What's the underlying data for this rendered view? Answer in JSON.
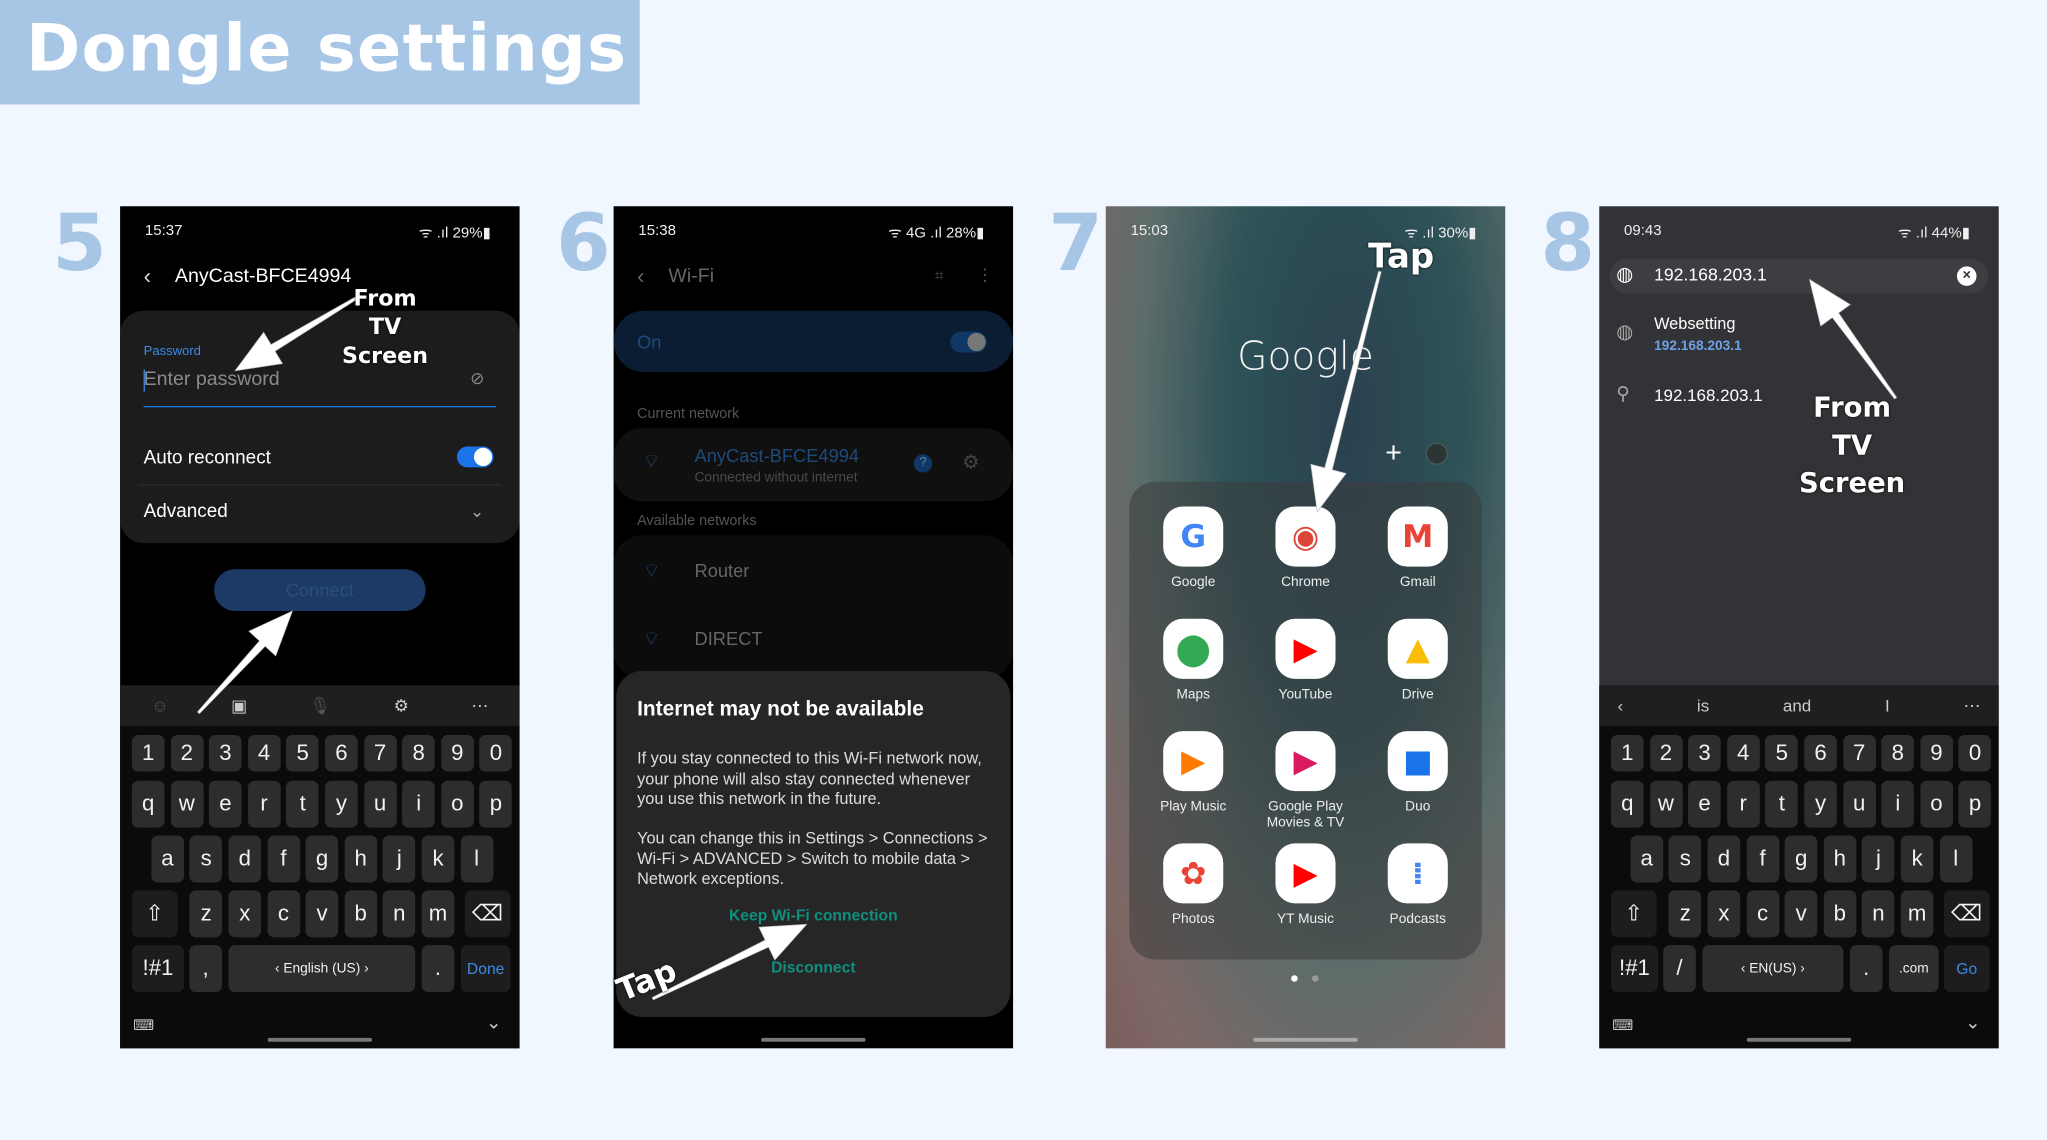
{
  "title": "Dongle settings",
  "steps": [
    "5",
    "6",
    "7",
    "8"
  ],
  "phone5": {
    "time": "15:37",
    "battery": "29%",
    "header": "AnyCast-BFCE4994",
    "password_label": "Password",
    "password_placeholder": "Enter password",
    "auto_reconnect": "Auto reconnect",
    "auto_reconnect_on": true,
    "advanced": "Advanced",
    "connect": "Connect",
    "annotation": "From\nTV\nScreen",
    "keyboard": {
      "space": "English (US)",
      "action": "Done",
      "sym": "!#1",
      "left": ",",
      "right": "."
    }
  },
  "phone6": {
    "time": "15:38",
    "battery": "28%",
    "header": "Wi-Fi",
    "toggle_label": "On",
    "current_network_label": "Current network",
    "current_network": "AnyCast-BFCE4994",
    "current_status": "Connected without internet",
    "available_label": "Available networks",
    "networks": [
      "Router",
      "DIRECT"
    ],
    "dialog": {
      "title": "Internet may not be available",
      "body1": "If you stay connected to this Wi-Fi network now, your phone will also stay connected whenever you use this network in the future.",
      "body2": "You can change this in Settings > Connections > Wi-Fi > ADVANCED > Switch to mobile data > Network exceptions.",
      "keep": "Keep Wi-Fi connection",
      "disconnect": "Disconnect"
    },
    "annotation": "Tap"
  },
  "phone7": {
    "time": "15:03",
    "battery": "30%",
    "folder_title": "Google",
    "annotation": "Tap",
    "apps": [
      {
        "label": "Google",
        "glyph": "G",
        "color": "#4285f4"
      },
      {
        "label": "Chrome",
        "glyph": "◉",
        "color": "#db4437"
      },
      {
        "label": "Gmail",
        "glyph": "M",
        "color": "#ea4335"
      },
      {
        "label": "Maps",
        "glyph": "⬤",
        "color": "#34a853"
      },
      {
        "label": "YouTube",
        "glyph": "▶",
        "color": "#ff0000"
      },
      {
        "label": "Drive",
        "glyph": "▲",
        "color": "#fbbc04"
      },
      {
        "label": "Play Music",
        "glyph": "▶",
        "color": "#ff7a00"
      },
      {
        "label": "Google Play Movies & TV",
        "glyph": "▶",
        "color": "#d81b60"
      },
      {
        "label": "Duo",
        "glyph": "■",
        "color": "#1a73e8"
      },
      {
        "label": "Photos",
        "glyph": "✿",
        "color": "#ea4335"
      },
      {
        "label": "YT Music",
        "glyph": "▶",
        "color": "#ff0000"
      },
      {
        "label": "Podcasts",
        "glyph": "⁞",
        "color": "#4285f4"
      }
    ]
  },
  "phone8": {
    "time": "09:43",
    "battery": "44%",
    "url": "192.168.203.1",
    "suggestion_title": "Websetting",
    "suggestion_url": "192.168.203.1",
    "search_suggestion": "192.168.203.1",
    "annotation": "From\nTV\nScreen",
    "word_suggestions": [
      "is",
      "and",
      "I"
    ],
    "keyboard": {
      "space": "EN(US)",
      "action": "Go",
      "sym": "!#1",
      "left": "/",
      "right": ".",
      "com": ".com"
    }
  },
  "keyboard_rows": [
    [
      "1",
      "2",
      "3",
      "4",
      "5",
      "6",
      "7",
      "8",
      "9",
      "0"
    ],
    [
      "q",
      "w",
      "e",
      "r",
      "t",
      "y",
      "u",
      "i",
      "o",
      "p"
    ],
    [
      "a",
      "s",
      "d",
      "f",
      "g",
      "h",
      "j",
      "k",
      "l"
    ],
    [
      "z",
      "x",
      "c",
      "v",
      "b",
      "n",
      "m"
    ]
  ],
  "colors": {
    "accent": "#a7c6e6",
    "blue": "#3b8ae8",
    "teal": "#0f8f7f"
  }
}
